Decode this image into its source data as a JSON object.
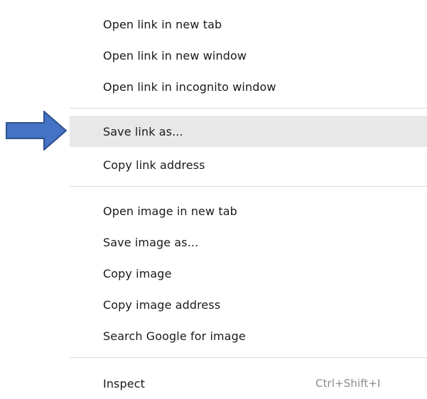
{
  "menu": {
    "items": [
      {
        "label": "Open link in new tab"
      },
      {
        "label": "Open link in new window"
      },
      {
        "label": "Open link in incognito window"
      },
      {
        "label": "Save link as..."
      },
      {
        "label": "Copy link address"
      },
      {
        "label": "Open image in new tab"
      },
      {
        "label": "Save image as..."
      },
      {
        "label": "Copy image"
      },
      {
        "label": "Copy image address"
      },
      {
        "label": "Search Google for image"
      },
      {
        "label": "Inspect",
        "shortcut": "Ctrl+Shift+I"
      }
    ]
  },
  "annotation": {
    "arrow_color": "#4472c4",
    "arrow_border_color": "#2f528f",
    "arrow_icon": "right-arrow-icon"
  },
  "colors": {
    "highlight": "#e8e8e8",
    "separator": "#dcdcdc",
    "text": "#1a1a1a",
    "shortcut_text": "#8c8c8c"
  }
}
